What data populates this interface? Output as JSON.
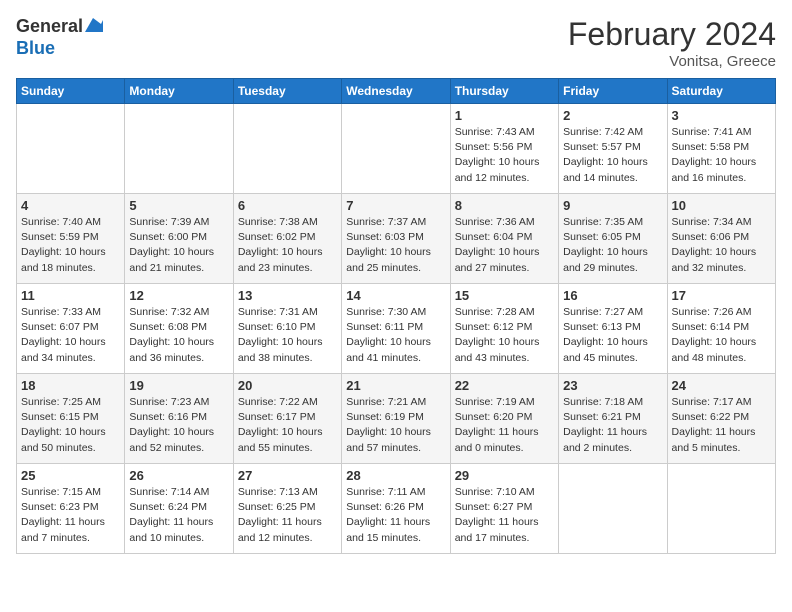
{
  "header": {
    "logo_general": "General",
    "logo_blue": "Blue",
    "month_title": "February 2024",
    "location": "Vonitsa, Greece"
  },
  "days_of_week": [
    "Sunday",
    "Monday",
    "Tuesday",
    "Wednesday",
    "Thursday",
    "Friday",
    "Saturday"
  ],
  "weeks": [
    [
      {
        "num": "",
        "info": ""
      },
      {
        "num": "",
        "info": ""
      },
      {
        "num": "",
        "info": ""
      },
      {
        "num": "",
        "info": ""
      },
      {
        "num": "1",
        "info": "Sunrise: 7:43 AM\nSunset: 5:56 PM\nDaylight: 10 hours\nand 12 minutes."
      },
      {
        "num": "2",
        "info": "Sunrise: 7:42 AM\nSunset: 5:57 PM\nDaylight: 10 hours\nand 14 minutes."
      },
      {
        "num": "3",
        "info": "Sunrise: 7:41 AM\nSunset: 5:58 PM\nDaylight: 10 hours\nand 16 minutes."
      }
    ],
    [
      {
        "num": "4",
        "info": "Sunrise: 7:40 AM\nSunset: 5:59 PM\nDaylight: 10 hours\nand 18 minutes."
      },
      {
        "num": "5",
        "info": "Sunrise: 7:39 AM\nSunset: 6:00 PM\nDaylight: 10 hours\nand 21 minutes."
      },
      {
        "num": "6",
        "info": "Sunrise: 7:38 AM\nSunset: 6:02 PM\nDaylight: 10 hours\nand 23 minutes."
      },
      {
        "num": "7",
        "info": "Sunrise: 7:37 AM\nSunset: 6:03 PM\nDaylight: 10 hours\nand 25 minutes."
      },
      {
        "num": "8",
        "info": "Sunrise: 7:36 AM\nSunset: 6:04 PM\nDaylight: 10 hours\nand 27 minutes."
      },
      {
        "num": "9",
        "info": "Sunrise: 7:35 AM\nSunset: 6:05 PM\nDaylight: 10 hours\nand 29 minutes."
      },
      {
        "num": "10",
        "info": "Sunrise: 7:34 AM\nSunset: 6:06 PM\nDaylight: 10 hours\nand 32 minutes."
      }
    ],
    [
      {
        "num": "11",
        "info": "Sunrise: 7:33 AM\nSunset: 6:07 PM\nDaylight: 10 hours\nand 34 minutes."
      },
      {
        "num": "12",
        "info": "Sunrise: 7:32 AM\nSunset: 6:08 PM\nDaylight: 10 hours\nand 36 minutes."
      },
      {
        "num": "13",
        "info": "Sunrise: 7:31 AM\nSunset: 6:10 PM\nDaylight: 10 hours\nand 38 minutes."
      },
      {
        "num": "14",
        "info": "Sunrise: 7:30 AM\nSunset: 6:11 PM\nDaylight: 10 hours\nand 41 minutes."
      },
      {
        "num": "15",
        "info": "Sunrise: 7:28 AM\nSunset: 6:12 PM\nDaylight: 10 hours\nand 43 minutes."
      },
      {
        "num": "16",
        "info": "Sunrise: 7:27 AM\nSunset: 6:13 PM\nDaylight: 10 hours\nand 45 minutes."
      },
      {
        "num": "17",
        "info": "Sunrise: 7:26 AM\nSunset: 6:14 PM\nDaylight: 10 hours\nand 48 minutes."
      }
    ],
    [
      {
        "num": "18",
        "info": "Sunrise: 7:25 AM\nSunset: 6:15 PM\nDaylight: 10 hours\nand 50 minutes."
      },
      {
        "num": "19",
        "info": "Sunrise: 7:23 AM\nSunset: 6:16 PM\nDaylight: 10 hours\nand 52 minutes."
      },
      {
        "num": "20",
        "info": "Sunrise: 7:22 AM\nSunset: 6:17 PM\nDaylight: 10 hours\nand 55 minutes."
      },
      {
        "num": "21",
        "info": "Sunrise: 7:21 AM\nSunset: 6:19 PM\nDaylight: 10 hours\nand 57 minutes."
      },
      {
        "num": "22",
        "info": "Sunrise: 7:19 AM\nSunset: 6:20 PM\nDaylight: 11 hours\nand 0 minutes."
      },
      {
        "num": "23",
        "info": "Sunrise: 7:18 AM\nSunset: 6:21 PM\nDaylight: 11 hours\nand 2 minutes."
      },
      {
        "num": "24",
        "info": "Sunrise: 7:17 AM\nSunset: 6:22 PM\nDaylight: 11 hours\nand 5 minutes."
      }
    ],
    [
      {
        "num": "25",
        "info": "Sunrise: 7:15 AM\nSunset: 6:23 PM\nDaylight: 11 hours\nand 7 minutes."
      },
      {
        "num": "26",
        "info": "Sunrise: 7:14 AM\nSunset: 6:24 PM\nDaylight: 11 hours\nand 10 minutes."
      },
      {
        "num": "27",
        "info": "Sunrise: 7:13 AM\nSunset: 6:25 PM\nDaylight: 11 hours\nand 12 minutes."
      },
      {
        "num": "28",
        "info": "Sunrise: 7:11 AM\nSunset: 6:26 PM\nDaylight: 11 hours\nand 15 minutes."
      },
      {
        "num": "29",
        "info": "Sunrise: 7:10 AM\nSunset: 6:27 PM\nDaylight: 11 hours\nand 17 minutes."
      },
      {
        "num": "",
        "info": ""
      },
      {
        "num": "",
        "info": ""
      }
    ]
  ]
}
